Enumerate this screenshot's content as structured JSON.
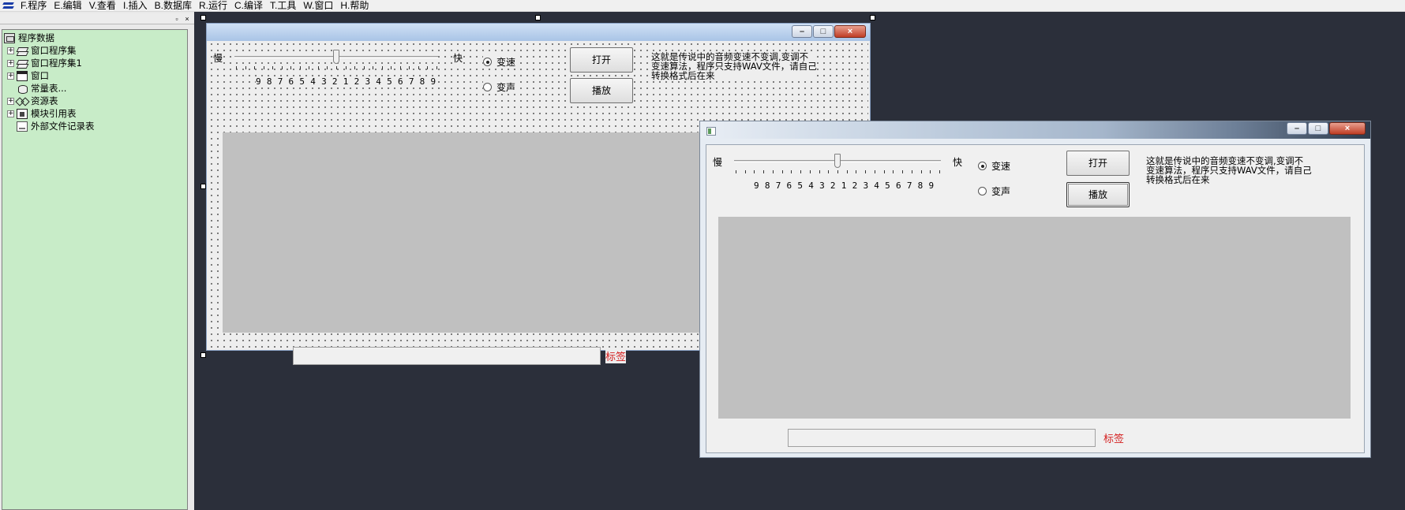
{
  "menu": {
    "items": [
      "F.程序",
      "E.编辑",
      "V.查看",
      "I.插入",
      "B.数据库",
      "R.运行",
      "C.编译",
      "T.工具",
      "W.窗口",
      "H.帮助"
    ]
  },
  "panel": {
    "pin_glyph": "▫",
    "close_glyph": "×",
    "tree": {
      "root": "程序数据",
      "items": [
        {
          "label": "窗口程序集",
          "icon": "stack-icon",
          "expander": "+"
        },
        {
          "label": "窗口程序集1",
          "icon": "stack-icon",
          "expander": "+"
        },
        {
          "label": "窗口",
          "icon": "window-icon",
          "expander": "+"
        },
        {
          "label": "常量表...",
          "icon": "constant-icon",
          "expander": ""
        },
        {
          "label": "资源表",
          "icon": "resource-icon",
          "expander": "+"
        },
        {
          "label": "模块引用表",
          "icon": "module-icon",
          "expander": "+"
        },
        {
          "label": "外部文件记录表",
          "icon": "file-icon",
          "expander": ""
        }
      ]
    }
  },
  "form": {
    "slow_label": "慢",
    "fast_label": "快",
    "scale_digits": "9 8 7 6 5 4 3 2 1 2 3 4 5 6 7 8 9",
    "slider_value_fraction": 0.5,
    "radio_speed": "变速",
    "radio_pitch": "变声",
    "radio_speed_selected": true,
    "open_button": "打开",
    "play_button": "播放",
    "description": "这就是传说中的音频变速不变调,变调不变速算法，程序只支持WAV文件，请自己转换格式后在来",
    "label_text": "标签"
  },
  "window_caption": {
    "minimize": "–",
    "maximize": "□",
    "close": "×"
  },
  "colors": {
    "workspace": "#2b2f3a",
    "tree_background": "#c8ecc8",
    "label_red": "#d42020",
    "display_gray": "#c0c0c0"
  }
}
